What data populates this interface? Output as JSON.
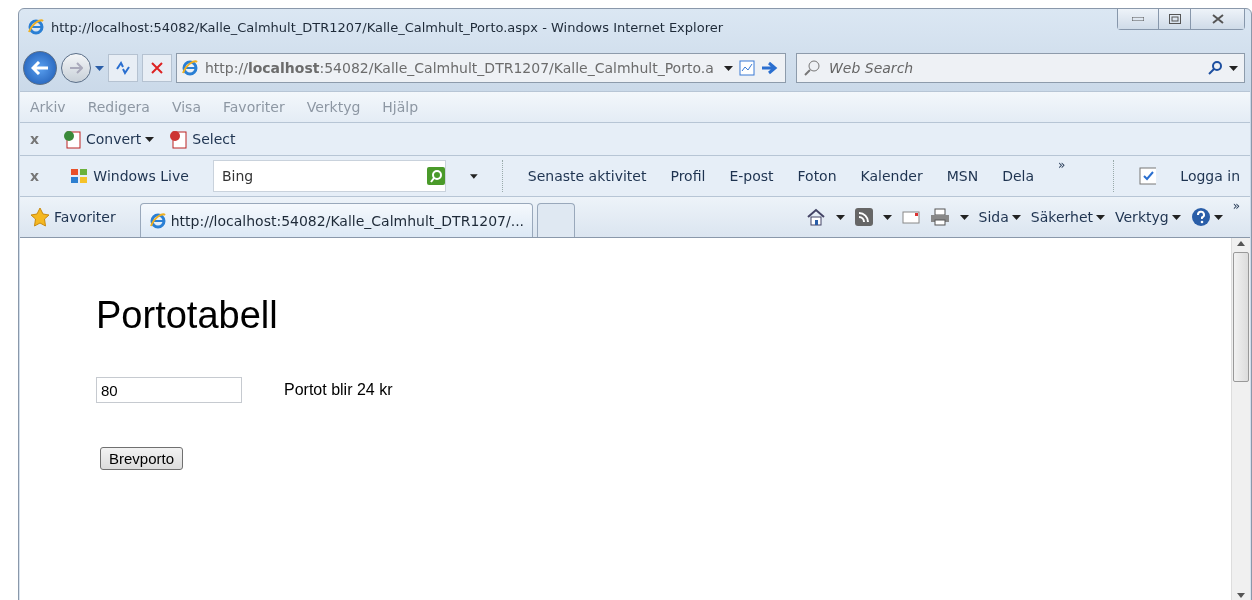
{
  "window": {
    "title": "http://localhost:54082/Kalle_Calmhult_DTR1207/Kalle_Calmhult_Porto.aspx - Windows Internet Explorer"
  },
  "nav": {
    "address": "http://**localhost**:54082/Kalle_Calmhult_DTR1207/Kalle_Calmhult_Porto.a",
    "search_placeholder": "Web Search"
  },
  "menu": [
    "Arkiv",
    "Redigera",
    "Visa",
    "Favoriter",
    "Verktyg",
    "Hjälp"
  ],
  "convert_toolbar": {
    "close": "x",
    "items": [
      {
        "label": "Convert",
        "kind": "dropdown"
      },
      {
        "label": "Select",
        "kind": "button"
      }
    ]
  },
  "live_toolbar": {
    "close": "x",
    "brand": "Windows Live",
    "search_value": "Bing",
    "links": [
      "Senaste aktivitet",
      "Profil",
      "E-post",
      "Foton",
      "Kalender",
      "MSN",
      "Dela"
    ],
    "overflow": "»",
    "login": "Logga in"
  },
  "favorites_bar": {
    "favorites": "Favoriter",
    "tabs": [
      {
        "label": "http://localhost:54082/Kalle_Calmhult_DTR1207/...",
        "selected": true
      },
      {
        "selected": false
      }
    ],
    "commands": [
      "Sida",
      "Säkerhet",
      "Verktyg"
    ],
    "overflow": "»"
  },
  "page": {
    "heading": "Portotabell",
    "weight_input": "80",
    "result": "Portot blir 24 kr",
    "button": "Brevporto"
  }
}
